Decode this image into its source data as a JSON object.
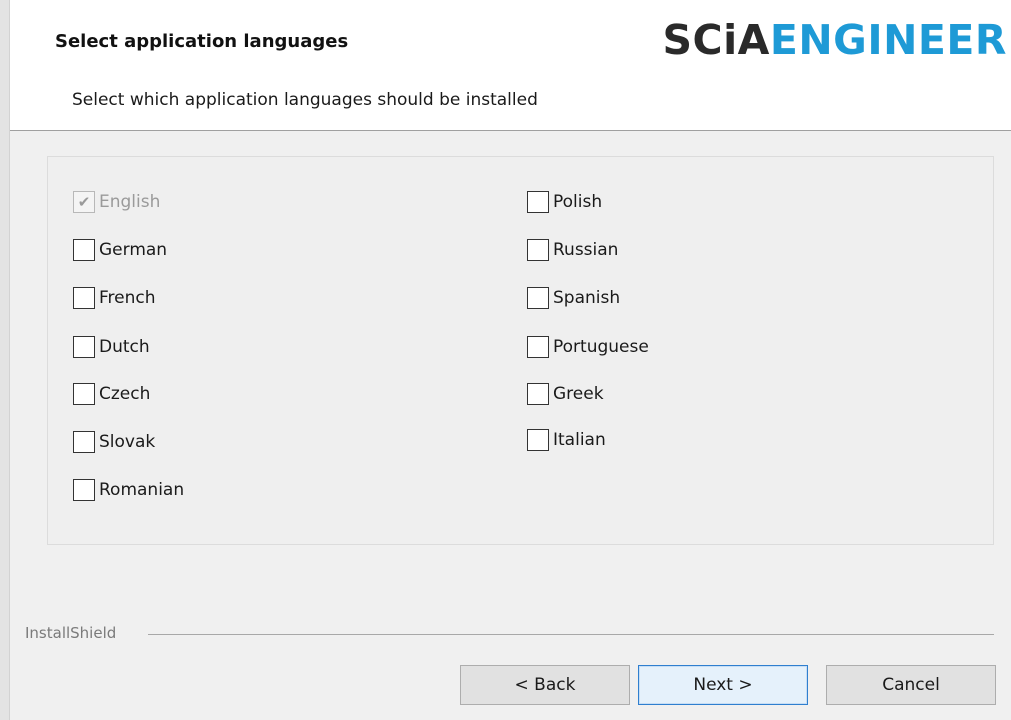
{
  "header": {
    "title": "Select application languages",
    "subtitle": "Select which application languages should be installed",
    "logo": {
      "part1": "SCiA",
      "part2": "ENGINEER",
      "part1_color": "#2a2a2a",
      "part2_color": "#1e9ad6"
    }
  },
  "languages": {
    "left": [
      {
        "label": "English",
        "checked": true,
        "disabled": true
      },
      {
        "label": "German",
        "checked": false
      },
      {
        "label": "French",
        "checked": false
      },
      {
        "label": "Dutch",
        "checked": false
      },
      {
        "label": "Czech",
        "checked": false
      },
      {
        "label": "Slovak",
        "checked": false
      },
      {
        "label": "Romanian",
        "checked": false
      }
    ],
    "right": [
      {
        "label": "Polish",
        "checked": false
      },
      {
        "label": "Russian",
        "checked": false
      },
      {
        "label": "Spanish",
        "checked": false
      },
      {
        "label": "Portuguese",
        "checked": false
      },
      {
        "label": "Greek",
        "checked": false
      },
      {
        "label": "Italian",
        "checked": false
      }
    ]
  },
  "footer": {
    "brand": "InstallShield",
    "back_label": "< Back",
    "next_label": "Next >",
    "cancel_label": "Cancel"
  }
}
